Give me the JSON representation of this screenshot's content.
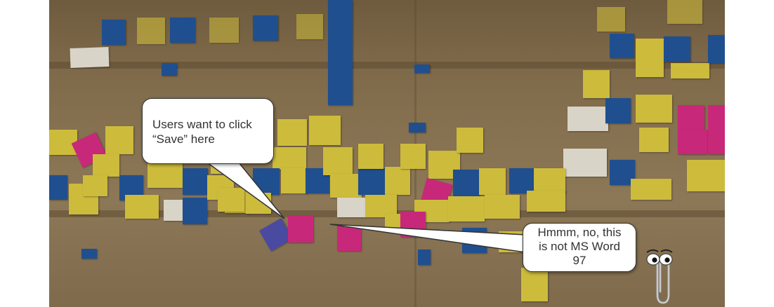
{
  "callouts": {
    "top": {
      "line1": "Users want to click",
      "line2": "“Save” here"
    },
    "bottom": {
      "line1": "Hmmm, no, this",
      "line2": "is not MS Word",
      "line3": "97"
    }
  },
  "colors": {
    "yellow_note": "#cdbb3c",
    "blue_note": "#1f4f8f",
    "pink_note": "#c8287a",
    "cork_board": "#85714f",
    "bubble_fill": "#ffffff"
  },
  "icons": {
    "assistant": "paperclip-assistant-icon"
  }
}
